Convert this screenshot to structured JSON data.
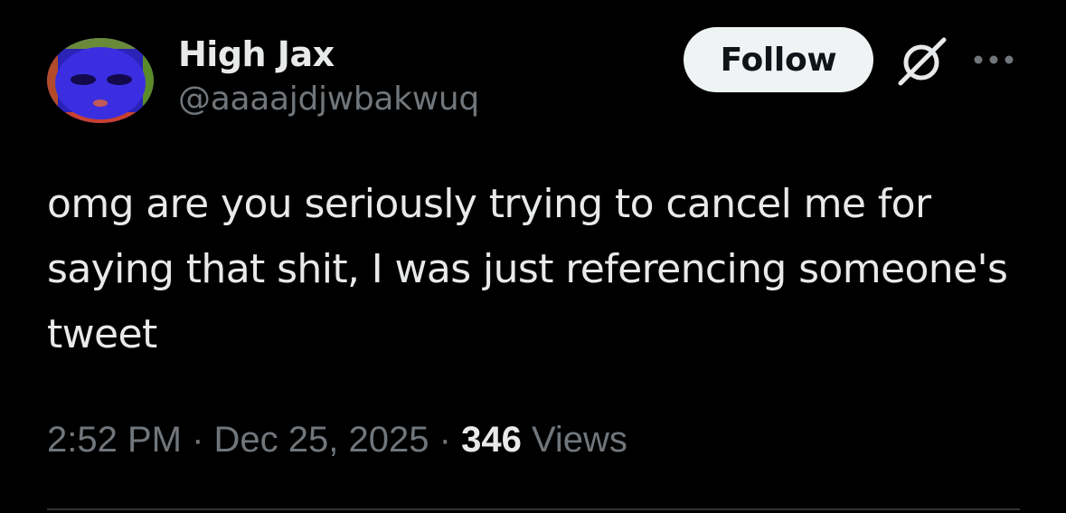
{
  "author": {
    "display_name": "High Jax",
    "handle": "@aaaajdjwbakwuq"
  },
  "actions": {
    "follow_label": "Follow",
    "grok_icon": "grok-icon",
    "more_icon": "more-icon"
  },
  "tweet": {
    "text": "omg are you seriously trying to cancel me for saying that shit, I was just referencing someone's tweet"
  },
  "meta": {
    "time": "2:52 PM",
    "separator": "·",
    "date": "Dec 25, 2025",
    "views_count": "346",
    "views_label": "Views"
  },
  "colors": {
    "background": "#000000",
    "primary_text": "#e7e9ea",
    "secondary_text": "#71767b",
    "follow_bg": "#eff3f4",
    "follow_text": "#0f1419",
    "divider": "#2f3336"
  }
}
